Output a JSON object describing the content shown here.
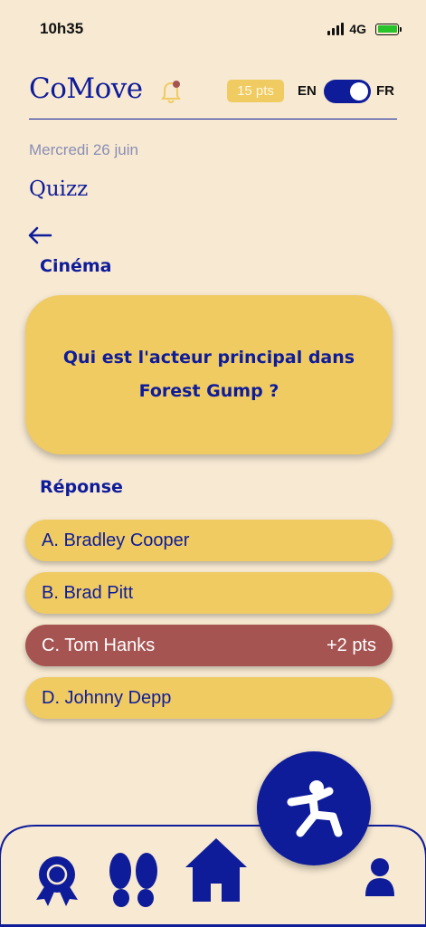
{
  "status_bar": {
    "time": "10h35",
    "network": "4G"
  },
  "header": {
    "app_name": "CoMove",
    "points": "15 pts",
    "lang_left": "EN",
    "lang_right": "FR"
  },
  "date": "Mercredi 26 juin",
  "page_title": "Quizz",
  "category": "Cinéma",
  "question": "Qui est l'acteur principal dans Forest Gump ?",
  "answers_label": "Réponse",
  "answers": [
    {
      "label": "A. Bradley Cooper",
      "state": "default"
    },
    {
      "label": "B. Brad Pitt",
      "state": "default"
    },
    {
      "label": "C. Tom Hanks",
      "state": "correct",
      "points": "+2 pts"
    },
    {
      "label": "D. Johnny Depp",
      "state": "default"
    }
  ],
  "nav": {
    "icons": [
      "award-icon",
      "footsteps-icon",
      "home-icon",
      "activity-icon",
      "profile-icon"
    ]
  },
  "colors": {
    "primary": "#0f1c9a",
    "accent": "#efcb62",
    "correct": "#a55452",
    "background": "#f7e9d2"
  }
}
